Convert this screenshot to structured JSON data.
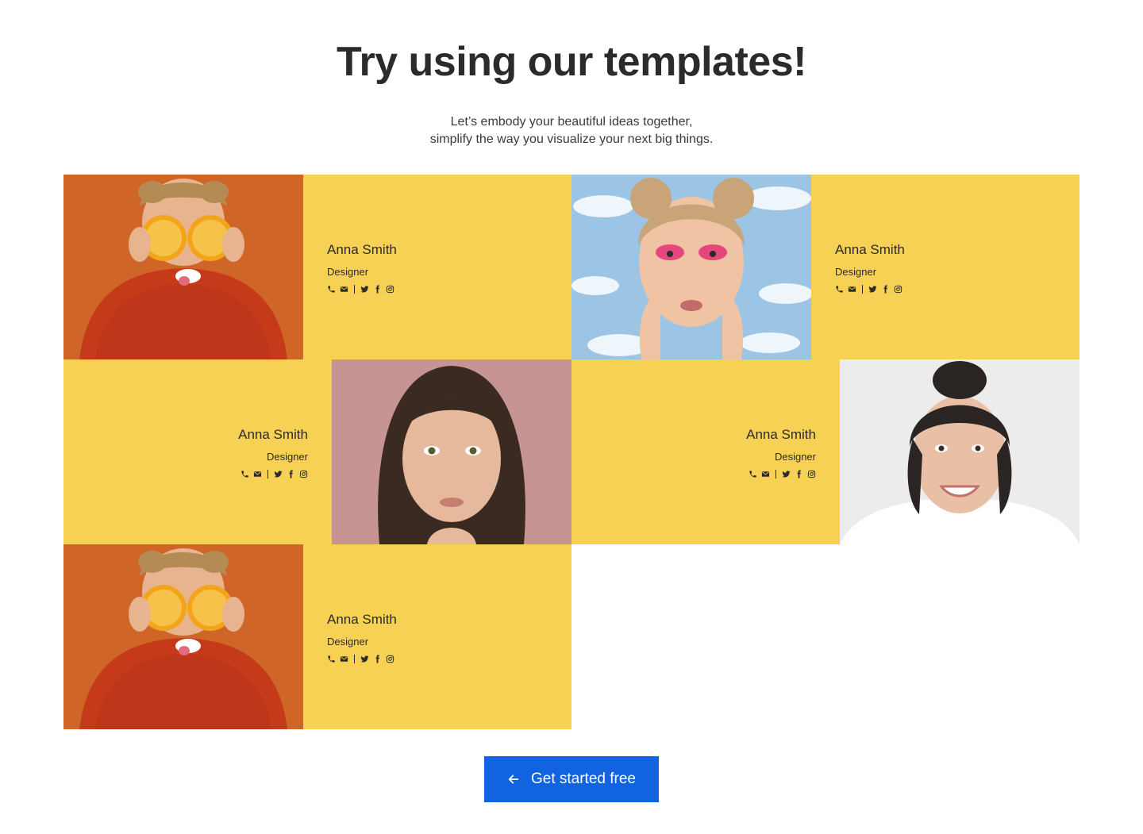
{
  "header": {
    "title": "Try using our templates!",
    "subtitle_line1": "Let’s embody your beautiful ideas together,",
    "subtitle_line2": "simplify the way you visualize your next big things."
  },
  "colors": {
    "card_background": "#f7d154",
    "cta_background": "#1163e0",
    "text": "#2b2b2b"
  },
  "cards": [
    {
      "name": "Anna Smith",
      "role": "Designer",
      "photo": "woman-orange-slices-photo",
      "photo_side": "left"
    },
    {
      "name": "Anna Smith",
      "role": "Designer",
      "photo": "woman-clouds-pink-eyeshadow-photo",
      "photo_side": "left"
    },
    {
      "name": "Anna Smith",
      "role": "Designer",
      "photo": "woman-bangs-pink-background-photo",
      "photo_side": "right"
    },
    {
      "name": "Anna Smith",
      "role": "Designer",
      "photo": "woman-smiling-bun-photo",
      "photo_side": "right"
    },
    {
      "name": "Anna Smith",
      "role": "Designer",
      "photo": "woman-orange-slices-photo",
      "photo_side": "left"
    }
  ],
  "contact_icons": [
    "phone-icon",
    "mail-icon",
    "twitter-icon",
    "facebook-icon",
    "instagram-icon"
  ],
  "cta": {
    "label": "Get started free",
    "icon": "arrow-left-icon"
  }
}
